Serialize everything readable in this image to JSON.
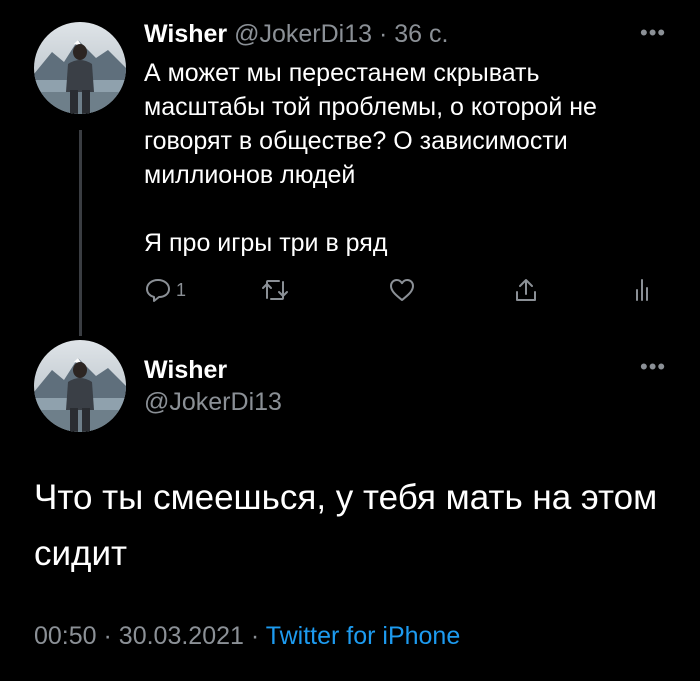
{
  "colors": {
    "background": "#000000",
    "text": "#ffffff",
    "secondary_text": "#8b9096",
    "link": "#1d9bf0",
    "thread_line": "#3a3d42"
  },
  "tweet1": {
    "avatar_icon": "avatar-photo",
    "display_name": "Wisher",
    "handle": "@JokerDi13",
    "separator": "·",
    "time": "36 с.",
    "more_icon": "more-dots-icon",
    "text_line1": "А может мы перестанем скрывать масштабы той проблемы, о которой не говорят в обществе? О зависимости миллионов людей",
    "text_line2": "Я про игры три в ряд",
    "actions": {
      "reply_icon": "reply-icon",
      "reply_count": "1",
      "retweet_icon": "retweet-icon",
      "like_icon": "like-icon",
      "share_icon": "share-icon",
      "analytics_icon": "analytics-icon"
    }
  },
  "tweet2": {
    "avatar_icon": "avatar-photo",
    "display_name": "Wisher",
    "handle": "@JokerDi13",
    "more_icon": "more-dots-icon",
    "text": "Что ты смеешься, у тебя мать на этом сидит",
    "time": "00:50",
    "separator1": "·",
    "date": "30.03.2021",
    "separator2": "·",
    "source": "Twitter for iPhone"
  }
}
